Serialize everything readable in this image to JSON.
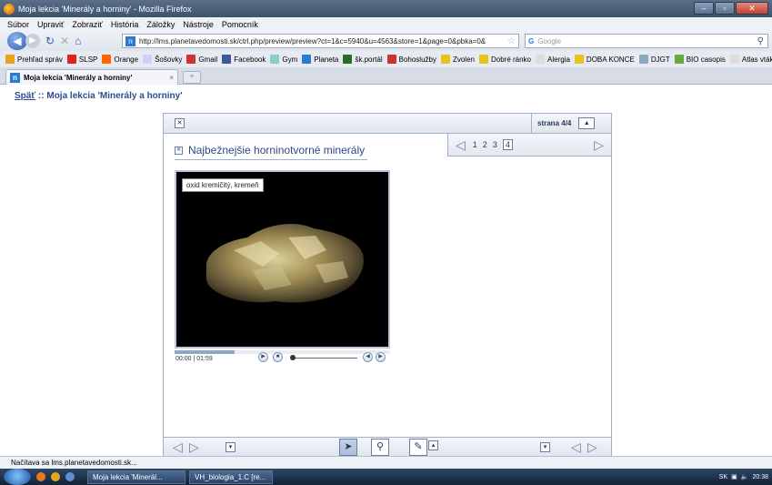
{
  "window": {
    "title": "Moja lekcia 'Minerály a horniny' - Mozilla Firefox"
  },
  "menu": [
    "Súbor",
    "Upraviť",
    "Zobraziť",
    "História",
    "Záložky",
    "Nástroje",
    "Pomocník"
  ],
  "nav": {
    "url": "http://lms.planetavedomosti.sk/ctrl.php/preview/preview?ct=1&c=5940&u=4563&store=1&page=0&pbka=0&",
    "search_placeholder": "Google"
  },
  "bookmarks": [
    "Prehľad správ",
    "SLSP",
    "Orange",
    "Šošovky",
    "Gmail",
    "Facebook",
    "Gym",
    "Planeta",
    "šk.portál",
    "Bohoslužby",
    "Zvolen",
    "Dobré ránko",
    "Alergia",
    "DOBA KONCE",
    "DJGT",
    "BIO casopis",
    "Atlas vtákov"
  ],
  "tab": {
    "label": "Moja lekcia 'Minerály a horniny'",
    "new_tab": "+"
  },
  "page": {
    "back_link": "Späť",
    "crumb_rest": " :: Moja lekcia 'Minerály a horniny'",
    "strana_label": "strana",
    "strana_value": "4/4",
    "pages": [
      "1",
      "2",
      "3",
      "4"
    ],
    "current_page": "4",
    "heading": "Najbežnejšie horninotvorné minerály",
    "caption": "oxid kremičitý, kremeň",
    "time_current": "00:00",
    "time_total": "01:59"
  },
  "status": {
    "text": "Načítava sa lms.planetavedomosti.sk..."
  },
  "taskbar": {
    "tasks": [
      "Moja lekcia 'Minerál...",
      "VH_biologia_1.C [re..."
    ],
    "lang": "SK",
    "clock": "20:38"
  },
  "colors": {
    "accent": "#2b4a86",
    "frame_border": "#9fb0c8"
  }
}
